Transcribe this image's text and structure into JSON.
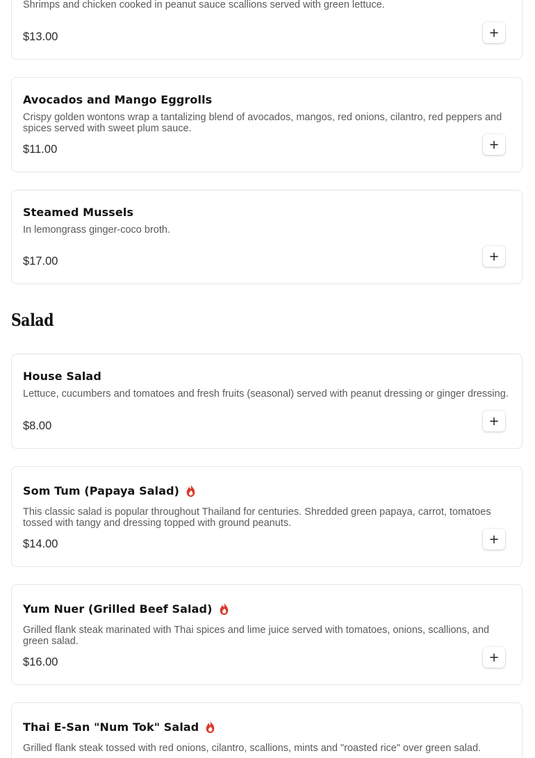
{
  "section": {
    "title": "Salad"
  },
  "items": [
    {
      "name": "",
      "description": "Shrimps and chicken cooked in peanut sauce scallions served with green lettuce.",
      "price": "$13.00",
      "add_label": "+"
    },
    {
      "name": "Avocados and Mango Eggrolls",
      "description": "Crispy golden wontons wrap a tantalizing blend of avocados, mangos, red onions, cilantro, red peppers and spices served with sweet plum sauce.",
      "price": "$11.00",
      "add_label": "+"
    },
    {
      "name": "Steamed Mussels",
      "description": "In lemongrass ginger-coco broth.",
      "price": "$17.00",
      "add_label": "+"
    },
    {
      "name": "House Salad",
      "description": "Lettuce, cucumbers and tomatoes and fresh fruits (seasonal) served with peanut dressing or ginger dressing.",
      "price": "$8.00",
      "add_label": "+"
    },
    {
      "name": "Som Tum (Papaya Salad)",
      "spicy": true,
      "description": "This classic salad is popular throughout Thailand for centuries. Shredded green papaya, carrot, tomatoes tossed with tangy and dressing topped with ground peanuts.",
      "price": "$14.00",
      "add_label": "+"
    },
    {
      "name": "Yum Nuer (Grilled Beef Salad)",
      "spicy": true,
      "description": "Grilled flank steak marinated with Thai spices and lime juice served with tomatoes, onions, scallions, and green salad.",
      "price": "$16.00",
      "add_label": "+"
    },
    {
      "name": "Thai E-San \"Num Tok\" Salad",
      "spicy": true,
      "description": "Grilled flank steak tossed with red onions, cilantro, scallions, mints and \"roasted rice\" over green salad.",
      "price": "",
      "add_label": "+"
    }
  ],
  "icons": {
    "spicy": "flame-icon",
    "add": "plus-icon"
  },
  "colors": {
    "flame": "#d83a2a",
    "text": "#141414",
    "muted": "#5a5a5a",
    "border": "#e6e6e6"
  }
}
